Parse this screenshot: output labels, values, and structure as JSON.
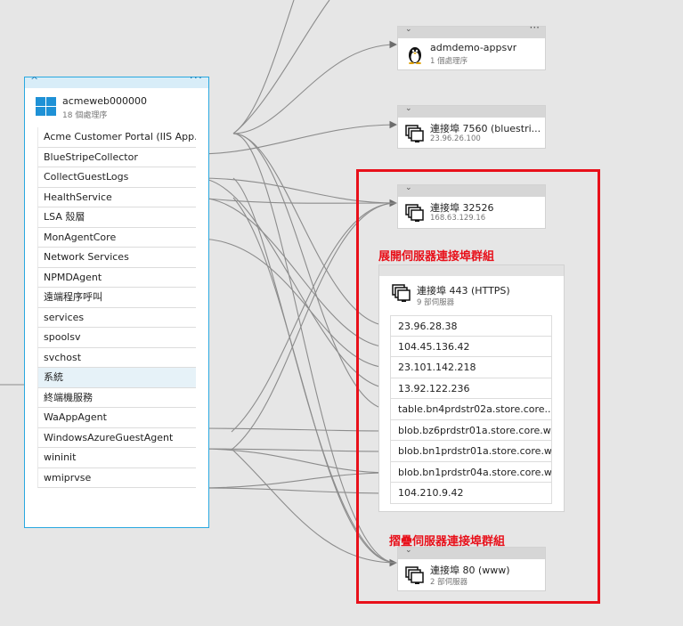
{
  "machine": {
    "name": "acmeweb000000",
    "subtitle": "18 個處理序",
    "processes": [
      "Acme Customer Portal (IIS App...",
      "BlueStripeCollector",
      "CollectGuestLogs",
      "HealthService",
      "LSA 殼層",
      "MonAgentCore",
      "Network Services",
      "NPMDAgent",
      "遠端程序呼叫",
      "services",
      "spoolsv",
      "svchost",
      "系統",
      "終端機服務",
      "WaAppAgent",
      "WindowsAzureGuestAgent",
      "wininit",
      "wmiprvse"
    ],
    "selected_index": 12
  },
  "nodes": {
    "admdemo": {
      "name": "admdemo-appsvr",
      "sub": "1 個處理序",
      "icon": "linux-penguin-icon"
    },
    "port7560": {
      "name": "連接埠 7560 (bluestri...",
      "sub": "23.96.26.100",
      "icon": "server-icon"
    },
    "port32526": {
      "name": "連接埠 32526",
      "sub": "168.63.129.16",
      "icon": "server-icon"
    },
    "port443": {
      "name": "連接埠 443 (HTTPS)",
      "sub": "9 部伺服器",
      "icon": "server-icon"
    },
    "port80": {
      "name": "連接埠 80 (www)",
      "sub": "2 部伺服器",
      "icon": "server-icon"
    }
  },
  "port443_servers": [
    "23.96.28.38",
    "104.45.136.42",
    "23.101.142.218",
    "13.92.122.236",
    "table.bn4prdstr02a.store.core....",
    "blob.bz6prdstr01a.store.core.w...",
    "blob.bn1prdstr01a.store.core.w...",
    "blob.bn1prdstr04a.store.core.w...",
    "104.210.9.42"
  ],
  "annotations": {
    "expanded": "展開伺服器連接埠群組",
    "collapsed": "摺疊伺服器連接埠群組"
  },
  "colors": {
    "accent": "#29a8e0",
    "annotation": "#e8101a",
    "line": "#8a8a8a"
  }
}
